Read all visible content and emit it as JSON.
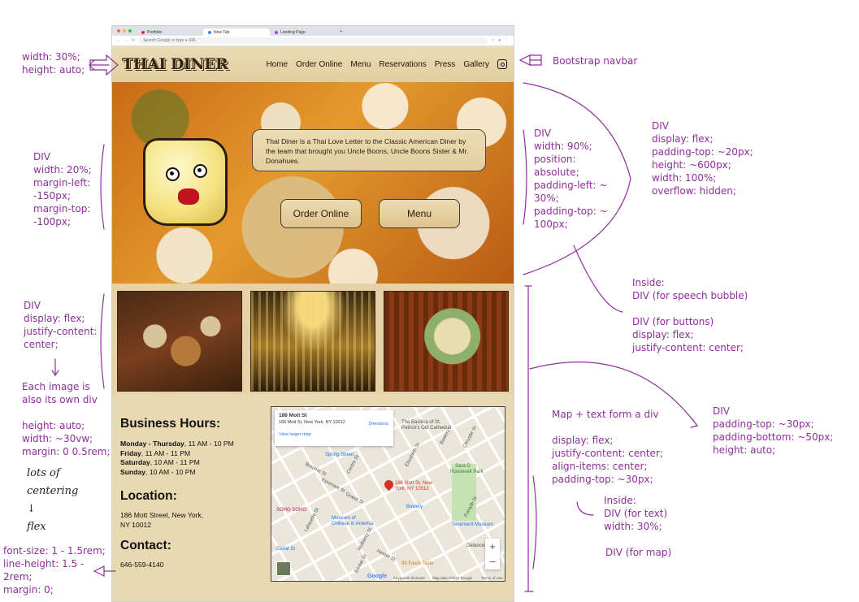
{
  "browser": {
    "tabs": [
      "Portfolio",
      "New Tab",
      "Landing Page"
    ],
    "address_placeholder": "Search Google or type a URL"
  },
  "site": {
    "logo": "THAI DINER",
    "nav": [
      "Home",
      "Order Online",
      "Menu",
      "Reservations",
      "Press",
      "Gallery"
    ],
    "instagram_icon": "instagram-icon",
    "bubble_text": "Thai Diner is a Thai Love Letter to the Classic American Diner by the team that brought you Uncle Boons, Uncle Boons Sister & Mr. Donahues.",
    "buttons": [
      "Order Online",
      "Menu"
    ],
    "hours_title": "Business Hours:",
    "hours": [
      {
        "day": "Monday - Thursday",
        "time": ", 11 AM - 10 PM"
      },
      {
        "day": "Friday",
        "time": ", 11 AM - 11 PM"
      },
      {
        "day": "Saturday",
        "time": ", 10 AM - 11 PM"
      },
      {
        "day": "Sunday",
        "time": ", 10 AM - 10 PM"
      }
    ],
    "location_title": "Location:",
    "address": [
      "186 Mott Street, New York,",
      "NY 10012"
    ],
    "contact_title": "Contact:",
    "phone": "646-559-4140",
    "map": {
      "card_title": "186 Mott St",
      "card_address": "186 Mott St, New York, NY 10012",
      "directions": "Directions",
      "larger_map": "View larger map",
      "pin_label": [
        "186 Mott St, New",
        "York, NY 10012"
      ],
      "labels": [
        "The Basilica of St.",
        "Patrick's Old Cathedral",
        "Spring Street",
        "Sara D",
        "Roosevelt Park",
        "Bowery",
        "SOHO SOHO",
        "Museum of",
        "Chinese in America",
        "Tenement Museum",
        "Delancey",
        "Canal St",
        "99 Favor Taste",
        "Grand St",
        "Broome St",
        "Kenmare St",
        "Bowery",
        "Mulberry St",
        "Elizabeth St",
        "Chrystie St",
        "Forsyth St",
        "Hester St",
        "Lafayette St",
        "Centre St",
        "Baxter St"
      ],
      "footer": [
        "Keyboard shortcuts",
        "Map data ©2022 Google",
        "Terms of Use"
      ],
      "google": "Google"
    }
  },
  "annotations": {
    "logo_note": "width: 30%;\nheight: auto;",
    "navbar_note": "Bootstrap navbar",
    "cake_note": "DIV\nwidth: 20%;\nmargin-left:\n-150px;\nmargin-top:\n-100px;",
    "overlay_note": "DIV\nwidth: 90%;\nposition:\nabsolute;\npadding-left: ~\n30%;\npadding-top: ~\n100px;",
    "hero_note": "DIV\ndisplay: flex;\npadding-top: ~20px;\nheight: ~600px;\nwidth: 100%;\noverflow: hidden;",
    "inside_note": "Inside:\nDIV (for speech bubble)\n\nDIV (for buttons)\ndisplay: flex;\njustify-content: center;",
    "photos_note": "DIV\ndisplay: flex;\njustify-content:\ncenter;",
    "image_note": "Each image is\nalso its own div",
    "image_size_note": "height: auto;\nwidth: ~30vw;\nmargin: 0 0.5rem;",
    "centering_note": "lots of\ncentering\n↓\nflex",
    "font_note": "font-size: 1 - 1.5rem;\nline-height: 1.5 -\n2rem;\nmargin: 0;",
    "section_note": "DIV\npadding-top: ~30px;\npadding-bottom: ~50px;\nheight: auto;",
    "mapdiv_note": "Map + text form a div",
    "flex_note": "display: flex;\njustify-content: center;\nalign-items: center;\npadding-top: ~30px;",
    "inside2_note": "Inside:\nDIV (for text)\nwidth: 30%;",
    "map_note": "DIV (for map)"
  }
}
